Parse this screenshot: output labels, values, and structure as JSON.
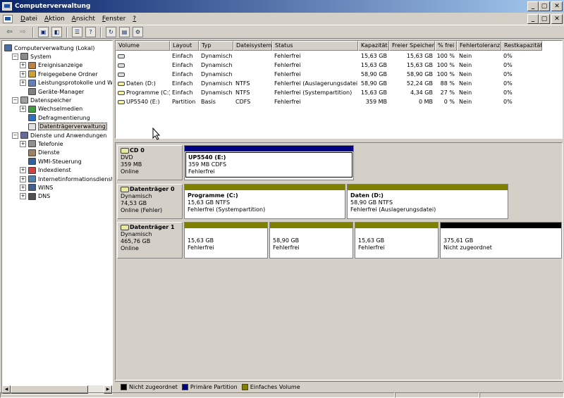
{
  "window": {
    "title": "Computerverwaltung",
    "controls": [
      "_",
      "▢",
      "✕"
    ],
    "mdi_controls": [
      "_",
      "▢",
      "✕"
    ]
  },
  "menu": [
    {
      "accel": "D",
      "rest": "atei"
    },
    {
      "accel": "A",
      "rest": "ktion"
    },
    {
      "accel": "A",
      "rest": "nsicht"
    },
    {
      "accel": "F",
      "rest": "enster"
    },
    {
      "accel": "?",
      "rest": ""
    }
  ],
  "toolbar": {
    "icons": [
      "back-arrow-icon",
      "forward-arrow-icon",
      "up-folder-icon",
      "show-tree-icon",
      "properties-icon",
      "help-icon",
      "refresh-icon",
      "export-icon",
      "settings-icon"
    ]
  },
  "tree": {
    "items": [
      {
        "label": "Computerverwaltung (Lokal)",
        "level": 0,
        "expander": "",
        "icon": "computer-icon"
      },
      {
        "label": "System",
        "level": 1,
        "expander": "−",
        "icon": "system-tools-icon"
      },
      {
        "label": "Ereignisanzeige",
        "level": 2,
        "expander": "+",
        "icon": "event-viewer-icon"
      },
      {
        "label": "Freigegebene Ordner",
        "level": 2,
        "expander": "+",
        "icon": "shared-folder-icon"
      },
      {
        "label": "Leistungsprotokolle und Warnungen",
        "level": 2,
        "expander": "+",
        "icon": "performance-icon"
      },
      {
        "label": "Geräte-Manager",
        "level": 2,
        "expander": "",
        "icon": "device-manager-icon"
      },
      {
        "label": "Datenspeicher",
        "level": 1,
        "expander": "−",
        "icon": "storage-icon"
      },
      {
        "label": "Wechselmedien",
        "level": 2,
        "expander": "+",
        "icon": "removable-media-icon"
      },
      {
        "label": "Defragmentierung",
        "level": 2,
        "expander": "",
        "icon": "defrag-icon"
      },
      {
        "label": "Datenträgerverwaltung",
        "level": 2,
        "expander": "",
        "icon": "disk-management-icon",
        "selected": true
      },
      {
        "label": "Dienste und Anwendungen",
        "level": 1,
        "expander": "−",
        "icon": "services-apps-icon"
      },
      {
        "label": "Telefonie",
        "level": 2,
        "expander": "+",
        "icon": "telephony-icon"
      },
      {
        "label": "Dienste",
        "level": 2,
        "expander": "",
        "icon": "services-icon"
      },
      {
        "label": "WMI-Steuerung",
        "level": 2,
        "expander": "",
        "icon": "wmi-icon"
      },
      {
        "label": "Indexdienst",
        "level": 2,
        "expander": "+",
        "icon": "indexing-icon"
      },
      {
        "label": "Internetinformationsdienste",
        "level": 2,
        "expander": "+",
        "icon": "iis-icon"
      },
      {
        "label": "WINS",
        "level": 2,
        "expander": "+",
        "icon": "wins-icon"
      },
      {
        "label": "DNS",
        "level": 2,
        "expander": "+",
        "icon": "dns-icon"
      }
    ]
  },
  "volume_list": {
    "columns": [
      "Volume",
      "Layout",
      "Typ",
      "Dateisystem",
      "Status",
      "Kapazität",
      "Freier Speicher",
      "% frei",
      "Fehlertoleranz",
      "Restkapazität"
    ],
    "rows": [
      [
        "",
        "Einfach",
        "Dynamisch",
        "",
        "Fehlerfrei",
        "15,63 GB",
        "15,63 GB",
        "100 %",
        "Nein",
        "0%"
      ],
      [
        "",
        "Einfach",
        "Dynamisch",
        "",
        "Fehlerfrei",
        "15,63 GB",
        "15,63 GB",
        "100 %",
        "Nein",
        "0%"
      ],
      [
        "",
        "Einfach",
        "Dynamisch",
        "",
        "Fehlerfrei",
        "58,90 GB",
        "58,90 GB",
        "100 %",
        "Nein",
        "0%"
      ],
      [
        "Daten (D:)",
        "Einfach",
        "Dynamisch",
        "NTFS",
        "Fehlerfrei (Auslagerungsdatei)",
        "58,90 GB",
        "52,24 GB",
        "88 %",
        "Nein",
        "0%"
      ],
      [
        "Programme (C:)",
        "Einfach",
        "Dynamisch",
        "NTFS",
        "Fehlerfrei (Systempartition)",
        "15,63 GB",
        "4,34 GB",
        "27 %",
        "Nein",
        "0%"
      ],
      [
        "UP5540 (E:)",
        "Partition",
        "Basis",
        "CDFS",
        "Fehlerfrei",
        "359 MB",
        "0 MB",
        "0 %",
        "Nein",
        "0%"
      ]
    ]
  },
  "disks": [
    {
      "name": "CD 0",
      "type": "DVD",
      "size": "359 MB",
      "status": "Online",
      "partitions": [
        {
          "name": "UP5540  (E:)",
          "size": "359 MB CDFS",
          "status": "Fehlerfrei",
          "kind": "primary",
          "share": 1
        }
      ]
    },
    {
      "name": "Datenträger 0",
      "type": "Dynamisch",
      "size": "74,53 GB",
      "status": "Online (Fehler)",
      "partitions": [
        {
          "name": "Programme  (C:)",
          "size": "15,63 GB NTFS",
          "status": "Fehlerfrei (Systempartition)",
          "kind": "simple",
          "share": 0.5
        },
        {
          "name": "Daten  (D:)",
          "size": "58,90 GB NTFS",
          "status": "Fehlerfrei (Auslagerungsdatei)",
          "kind": "simple",
          "share": 0.5
        }
      ]
    },
    {
      "name": "Datenträger 1",
      "type": "Dynamisch",
      "size": "465,76 GB",
      "status": "Online",
      "partitions": [
        {
          "name": "",
          "size": "15,63 GB",
          "status": "Fehlerfrei",
          "kind": "simple",
          "share": 0.225
        },
        {
          "name": "",
          "size": "58,90 GB",
          "status": "Fehlerfrei",
          "kind": "simple",
          "share": 0.225
        },
        {
          "name": "",
          "size": "15,63 GB",
          "status": "Fehlerfrei",
          "kind": "simple",
          "share": 0.225
        },
        {
          "name": "",
          "size": "375,61 GB",
          "status": "Nicht zugeordnet",
          "kind": "unallocated",
          "share": 0.325
        }
      ]
    }
  ],
  "legend": [
    {
      "label": "Nicht zugeordnet",
      "color": "#000000"
    },
    {
      "label": "Primäre Partition",
      "color": "#000080"
    },
    {
      "label": "Einfaches Volume",
      "color": "#808000"
    }
  ],
  "colors": {
    "unallocated": "#000000",
    "primary": "#000080",
    "simple": "#808000",
    "titlebar_start": "#0a246a",
    "titlebar_end": "#a6caf0"
  }
}
